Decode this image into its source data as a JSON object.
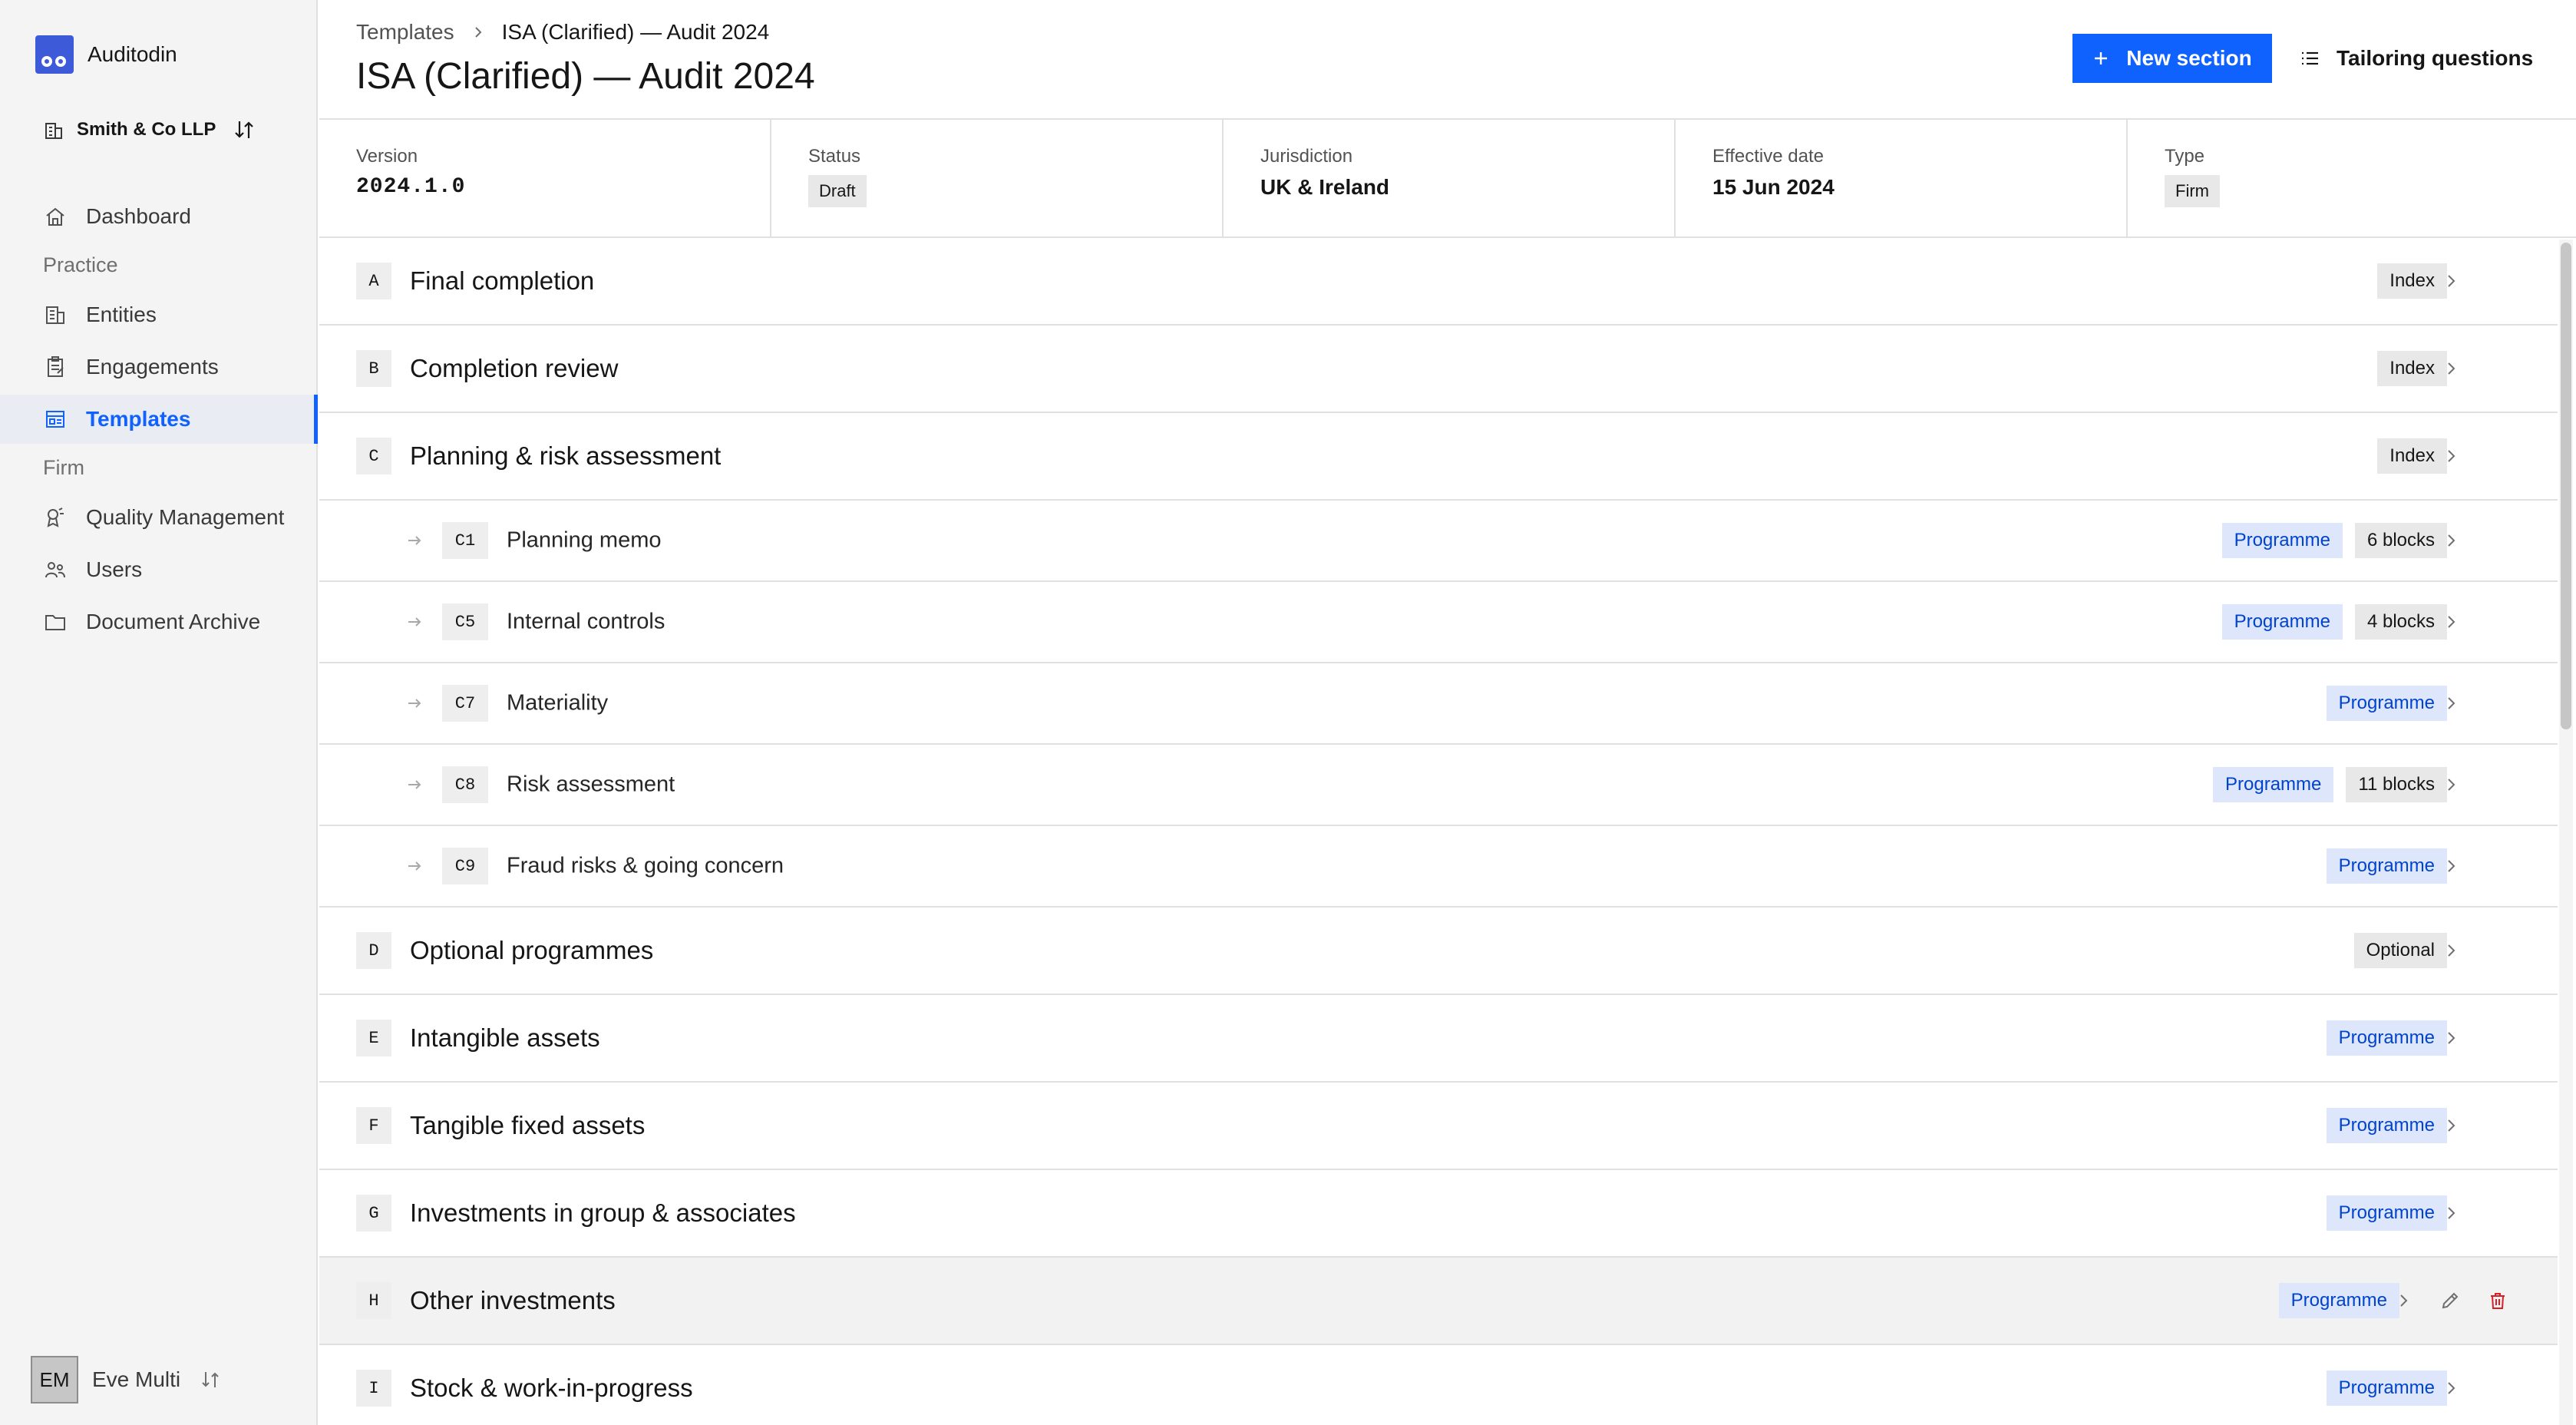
{
  "app": {
    "name": "Auditodin"
  },
  "org": {
    "name": "Smith & Co LLP"
  },
  "nav": {
    "dashboard": "Dashboard",
    "group_practice": "Practice",
    "entities": "Entities",
    "engagements": "Engagements",
    "templates": "Templates",
    "group_firm": "Firm",
    "quality": "Quality Management",
    "users": "Users",
    "archive": "Document Archive"
  },
  "user": {
    "initials": "EM",
    "name": "Eve Multi"
  },
  "breadcrumb": {
    "parent": "Templates",
    "current": "ISA (Clarified) — Audit 2024"
  },
  "page": {
    "title": "ISA (Clarified) — Audit 2024"
  },
  "actions": {
    "new_section": "New section",
    "tailoring": "Tailoring questions"
  },
  "meta": {
    "version_label": "Version",
    "version_value": "2024.1.0",
    "status_label": "Status",
    "status_value": "Draft",
    "jurisdiction_label": "Jurisdiction",
    "jurisdiction_value": "UK & Ireland",
    "effective_label": "Effective date",
    "effective_value": "15 Jun 2024",
    "type_label": "Type",
    "type_value": "Firm"
  },
  "sections": [
    {
      "code": "A",
      "title": "Final completion",
      "tag": "Index"
    },
    {
      "code": "B",
      "title": "Completion review",
      "tag": "Index"
    },
    {
      "code": "C",
      "title": "Planning & risk assessment",
      "tag": "Index"
    },
    {
      "code": "C1",
      "title": "Planning memo",
      "tag": "Programme",
      "blocks": "6 blocks"
    },
    {
      "code": "C5",
      "title": "Internal controls",
      "tag": "Programme",
      "blocks": "4 blocks"
    },
    {
      "code": "C7",
      "title": "Materiality",
      "tag": "Programme"
    },
    {
      "code": "C8",
      "title": "Risk assessment",
      "tag": "Programme",
      "blocks": "11 blocks"
    },
    {
      "code": "C9",
      "title": "Fraud risks & going concern",
      "tag": "Programme"
    },
    {
      "code": "D",
      "title": "Optional programmes",
      "tag": "Optional"
    },
    {
      "code": "E",
      "title": "Intangible assets",
      "tag": "Programme"
    },
    {
      "code": "F",
      "title": "Tangible fixed assets",
      "tag": "Programme"
    },
    {
      "code": "G",
      "title": "Investments in group & associates",
      "tag": "Programme"
    },
    {
      "code": "H",
      "title": "Other investments",
      "tag": "Programme"
    },
    {
      "code": "I",
      "title": "Stock & work-in-progress",
      "tag": "Programme"
    }
  ],
  "colors": {
    "accent": "#0f62fe",
    "danger": "#da1e28",
    "tag_blue_bg": "#dde6fb"
  }
}
